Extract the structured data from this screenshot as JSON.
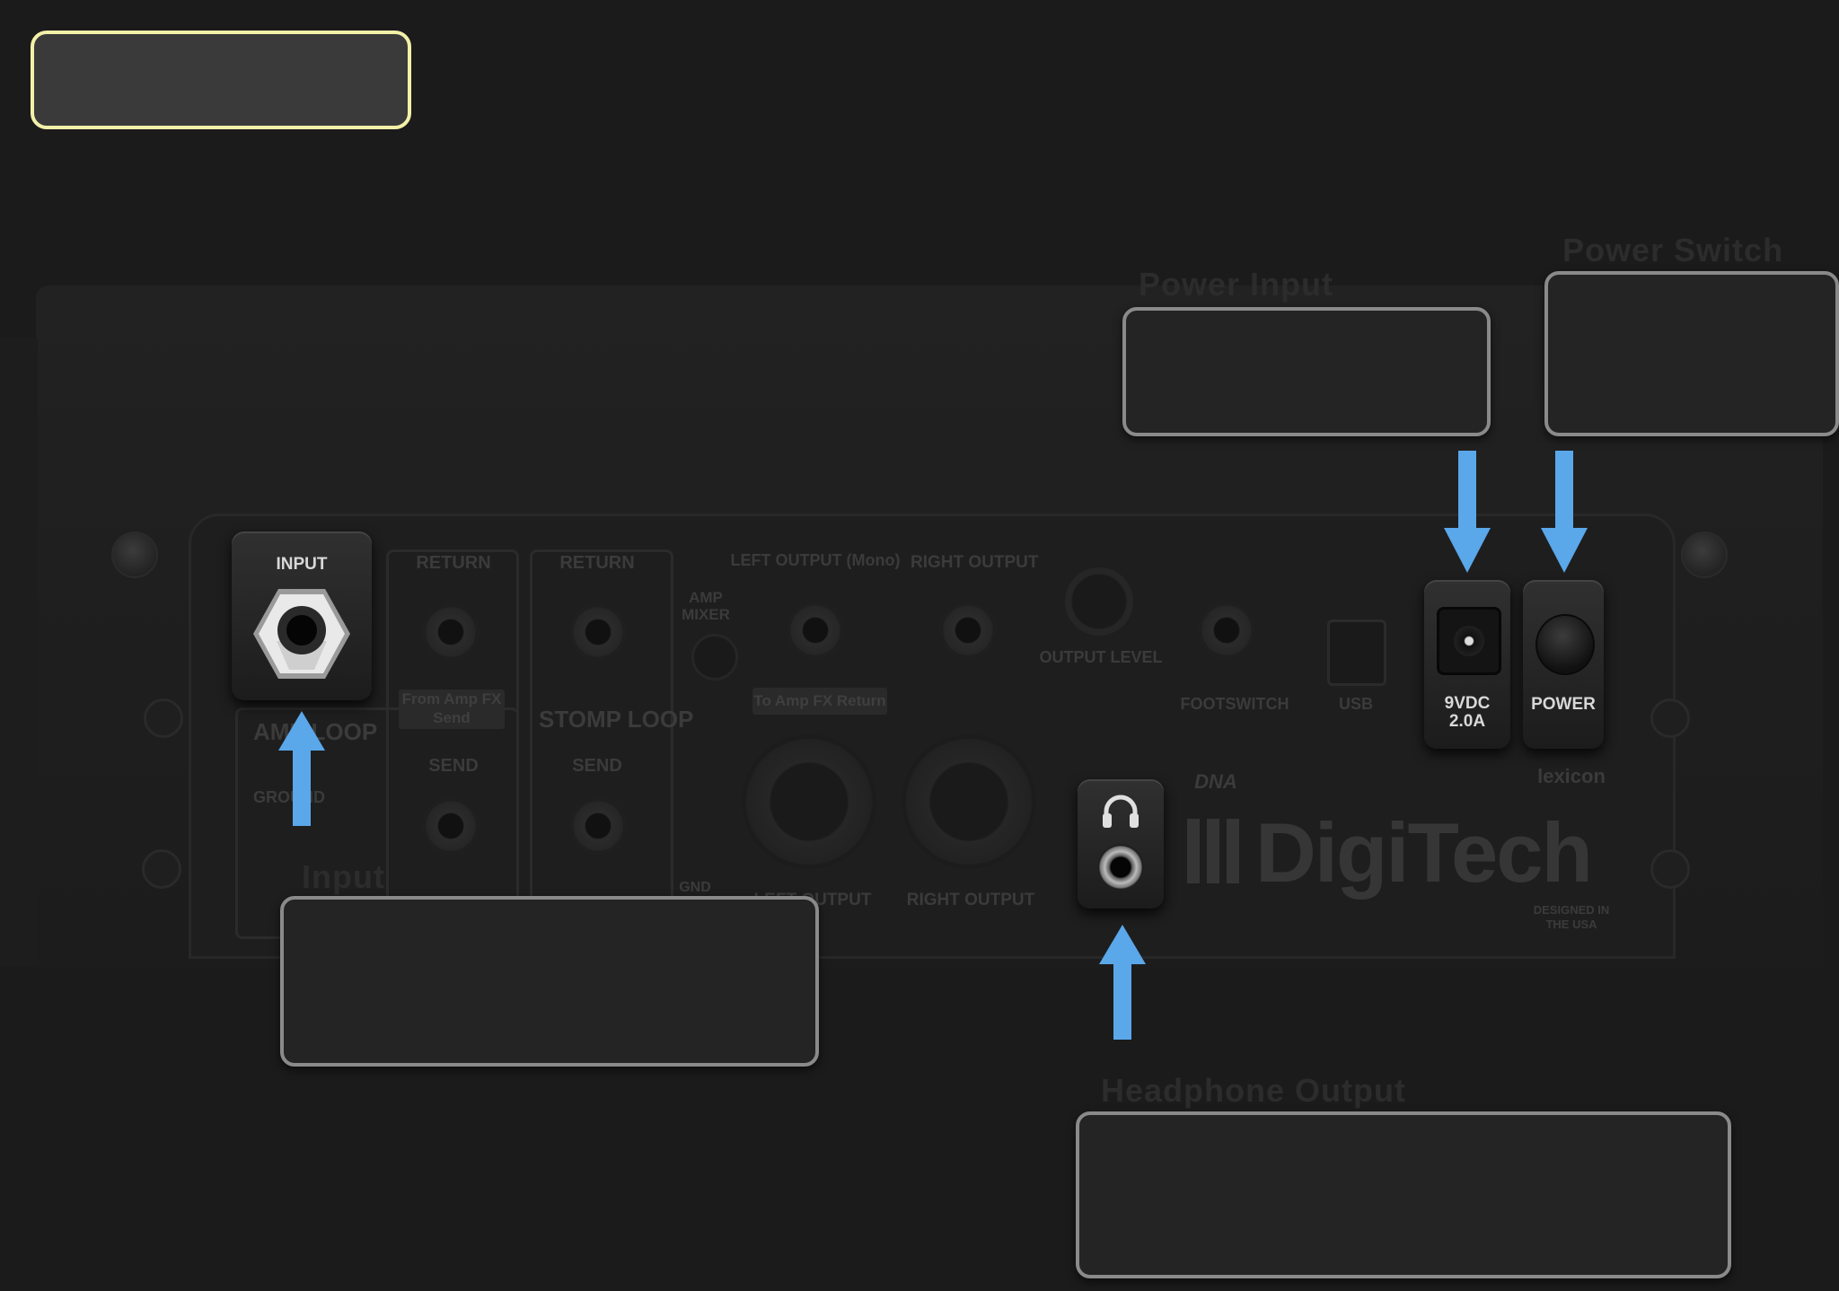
{
  "title_box": {
    "text": ""
  },
  "colors": {
    "arrow": "#5aa7ea",
    "title_border": "#f3f0a8",
    "callout_border": "#8a8a8a",
    "background": "#1b1b1b"
  },
  "hardware": {
    "input_label": "INPUT",
    "power_input_label": "9VDC\n2.0A",
    "power_switch_label": "POWER",
    "headphone_icon": "headphones-icon"
  },
  "ghost_panel": {
    "return_1": "RETURN",
    "return_2": "RETURN",
    "left_output": "LEFT OUTPUT (Mono)",
    "right_output": "RIGHT OUTPUT",
    "amp_mixer": "AMP MIXER",
    "output_level": "OUTPUT LEVEL",
    "footswitch": "FOOTSWITCH",
    "usb": "USB",
    "from_amp_fx_send": "From Amp FX Send",
    "to_amp_fx_return": "To Amp FX Return",
    "amp_loop": "AMP LOOP",
    "stomp_loop": "STOMP LOOP",
    "send_1": "SEND",
    "send_2": "SEND",
    "ground": "GROUND",
    "gnd": "GND",
    "left_output_xlr": "LEFT OUTPUT",
    "right_output_xlr": "RIGHT OUTPUT",
    "brand": "DigiTech",
    "dna": "DNA",
    "lexicon": "lexicon",
    "designed": "DESIGNED IN THE USA"
  },
  "callouts": {
    "power_input": {
      "label": "Power Input",
      "text": ""
    },
    "power_switch": {
      "label": "Power Switch",
      "text": ""
    },
    "input": {
      "label": "Input",
      "text": ""
    },
    "headphone_output": {
      "label": "Headphone Output",
      "text": ""
    }
  }
}
